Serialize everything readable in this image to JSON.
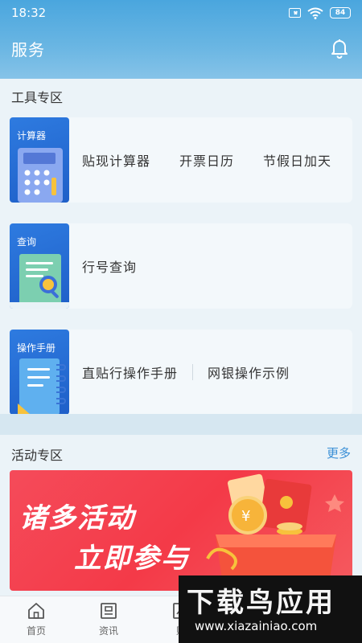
{
  "status_bar": {
    "time": "18:32",
    "battery": "84"
  },
  "app_bar": {
    "title": "服务"
  },
  "tools": {
    "title": "工具专区",
    "cards": [
      {
        "tag": "计算器",
        "links": [
          "贴现计算器",
          "开票日历",
          "节假日加天"
        ]
      },
      {
        "tag": "查询",
        "links": [
          "行号查询"
        ]
      },
      {
        "tag": "操作手册",
        "links": [
          "直贴行操作手册",
          "网银操作示例"
        ]
      }
    ]
  },
  "activity": {
    "title": "活动专区",
    "more": "更多",
    "banner_line1": "诸多活动",
    "banner_line2": "立即参与"
  },
  "bottom_nav": [
    {
      "label": "首页"
    },
    {
      "label": "资讯"
    },
    {
      "label": "贴"
    }
  ],
  "watermark": {
    "title": "下载鸟应用",
    "url": "www.xiazainiao.com"
  }
}
